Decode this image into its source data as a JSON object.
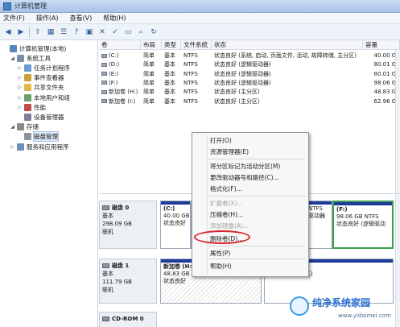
{
  "window": {
    "title": "计算机管理"
  },
  "menu": [
    "文件(F)",
    "操作(A)",
    "查看(V)",
    "帮助(H)"
  ],
  "toolbar_icons": [
    "back-icon",
    "forward-icon",
    "up-folder-icon",
    "show-tree-icon",
    "properties-icon",
    "help-icon",
    "console-icon",
    "delete-icon",
    "check-icon",
    "folder-open-icon",
    "search-icon",
    "refresh-icon"
  ],
  "tree": [
    {
      "label": "计算机管理(本地)",
      "icon": "computer-icon",
      "indent": 0,
      "toggle": ""
    },
    {
      "label": "系统工具",
      "icon": "tools-icon",
      "indent": 1,
      "toggle": "◢"
    },
    {
      "label": "任务计划程序",
      "icon": "clock-icon",
      "indent": 2,
      "toggle": "▷"
    },
    {
      "label": "事件查看器",
      "icon": "event-icon",
      "indent": 2,
      "toggle": "▷"
    },
    {
      "label": "共享文件夹",
      "icon": "folder-icon",
      "indent": 2,
      "toggle": "▷"
    },
    {
      "label": "本地用户和组",
      "icon": "users-icon",
      "indent": 2,
      "toggle": "▷"
    },
    {
      "label": "性能",
      "icon": "performance-icon",
      "indent": 2,
      "toggle": "▷"
    },
    {
      "label": "设备管理器",
      "icon": "device-icon",
      "indent": 2,
      "toggle": ""
    },
    {
      "label": "存储",
      "icon": "storage-icon",
      "indent": 1,
      "toggle": "◢"
    },
    {
      "label": "磁盘管理",
      "icon": "disk-icon",
      "indent": 2,
      "toggle": "",
      "selected": true
    },
    {
      "label": "服务和应用程序",
      "icon": "services-icon",
      "indent": 1,
      "toggle": "▷"
    }
  ],
  "volume_columns": [
    "卷",
    "布局",
    "类型",
    "文件系统",
    "状态",
    "容量"
  ],
  "volumes": [
    {
      "name": "(C:)",
      "layout": "简单",
      "type": "基本",
      "fs": "NTFS",
      "status": "状态良好 (系统, 启动, 页面文件, 活动, 故障转储, 主分区)",
      "capacity": "40.00 GB"
    },
    {
      "name": "(D:)",
      "layout": "简单",
      "type": "基本",
      "fs": "NTFS",
      "status": "状态良好 (逻辑驱动器)",
      "capacity": "80.01 GB"
    },
    {
      "name": "(E:)",
      "layout": "简单",
      "type": "基本",
      "fs": "NTFS",
      "status": "状态良好 (逻辑驱动器)",
      "capacity": "80.01 GB"
    },
    {
      "name": "(F:)",
      "layout": "简单",
      "type": "基本",
      "fs": "NTFS",
      "status": "状态良好 (逻辑驱动器)",
      "capacity": "98.06 GB"
    },
    {
      "name": "新加卷 (H:)",
      "layout": "简单",
      "type": "基本",
      "fs": "NTFS",
      "status": "状态良好 (主分区)",
      "capacity": "48.83 GB"
    },
    {
      "name": "新加卷 (I:)",
      "layout": "简单",
      "type": "基本",
      "fs": "NTFS",
      "status": "状态良好 (主分区)",
      "capacity": "62.96 GB"
    }
  ],
  "disks": [
    {
      "name": "磁盘 0",
      "type": "基本",
      "size": "298.09 GB",
      "state": "联机",
      "partitions": [
        {
          "name": "(C:)",
          "size": "40.00 GB",
          "status": "状态良好"
        },
        {
          "name": "",
          "size": "",
          "status": ""
        },
        {
          "name": "",
          "size": "NTFS",
          "status": "驱动器"
        },
        {
          "name": "(F:)",
          "size": "98.06 GB NTFS",
          "status": "状态良好 (逻辑驱动"
        }
      ]
    },
    {
      "name": "磁盘 1",
      "type": "基本",
      "size": "111.79 GB",
      "state": "联机",
      "partitions": [
        {
          "name": "新加卷 (H:)",
          "size": "48.83 GB NTFS",
          "status": "状态良好"
        },
        {
          "name": "",
          "size": "62.96 GB NTFS",
          "status": "状态良好 (主分区)"
        }
      ]
    },
    {
      "name": "CD-ROM 0"
    }
  ],
  "context_menu": {
    "items": [
      {
        "label": "打开(O)",
        "disabled": false
      },
      {
        "label": "资源管理器(E)",
        "disabled": false
      },
      {
        "label": "将分区标记为活动分区(M)",
        "disabled": false
      },
      {
        "label": "更改驱动器号和路径(C)...",
        "disabled": false
      },
      {
        "label": "格式化(F)...",
        "disabled": false
      },
      {
        "label": "扩展卷(X)...",
        "disabled": true
      },
      {
        "label": "压缩卷(H)...",
        "disabled": false
      },
      {
        "label": "添加镜像(A)...",
        "disabled": true
      },
      {
        "label": "删除卷(D)...",
        "disabled": false
      },
      {
        "label": "属性(P)",
        "disabled": false
      },
      {
        "label": "帮助(H)",
        "disabled": false
      }
    ]
  },
  "watermark": {
    "title": "纯净系统家园",
    "url": "www.yidaimei.com"
  }
}
